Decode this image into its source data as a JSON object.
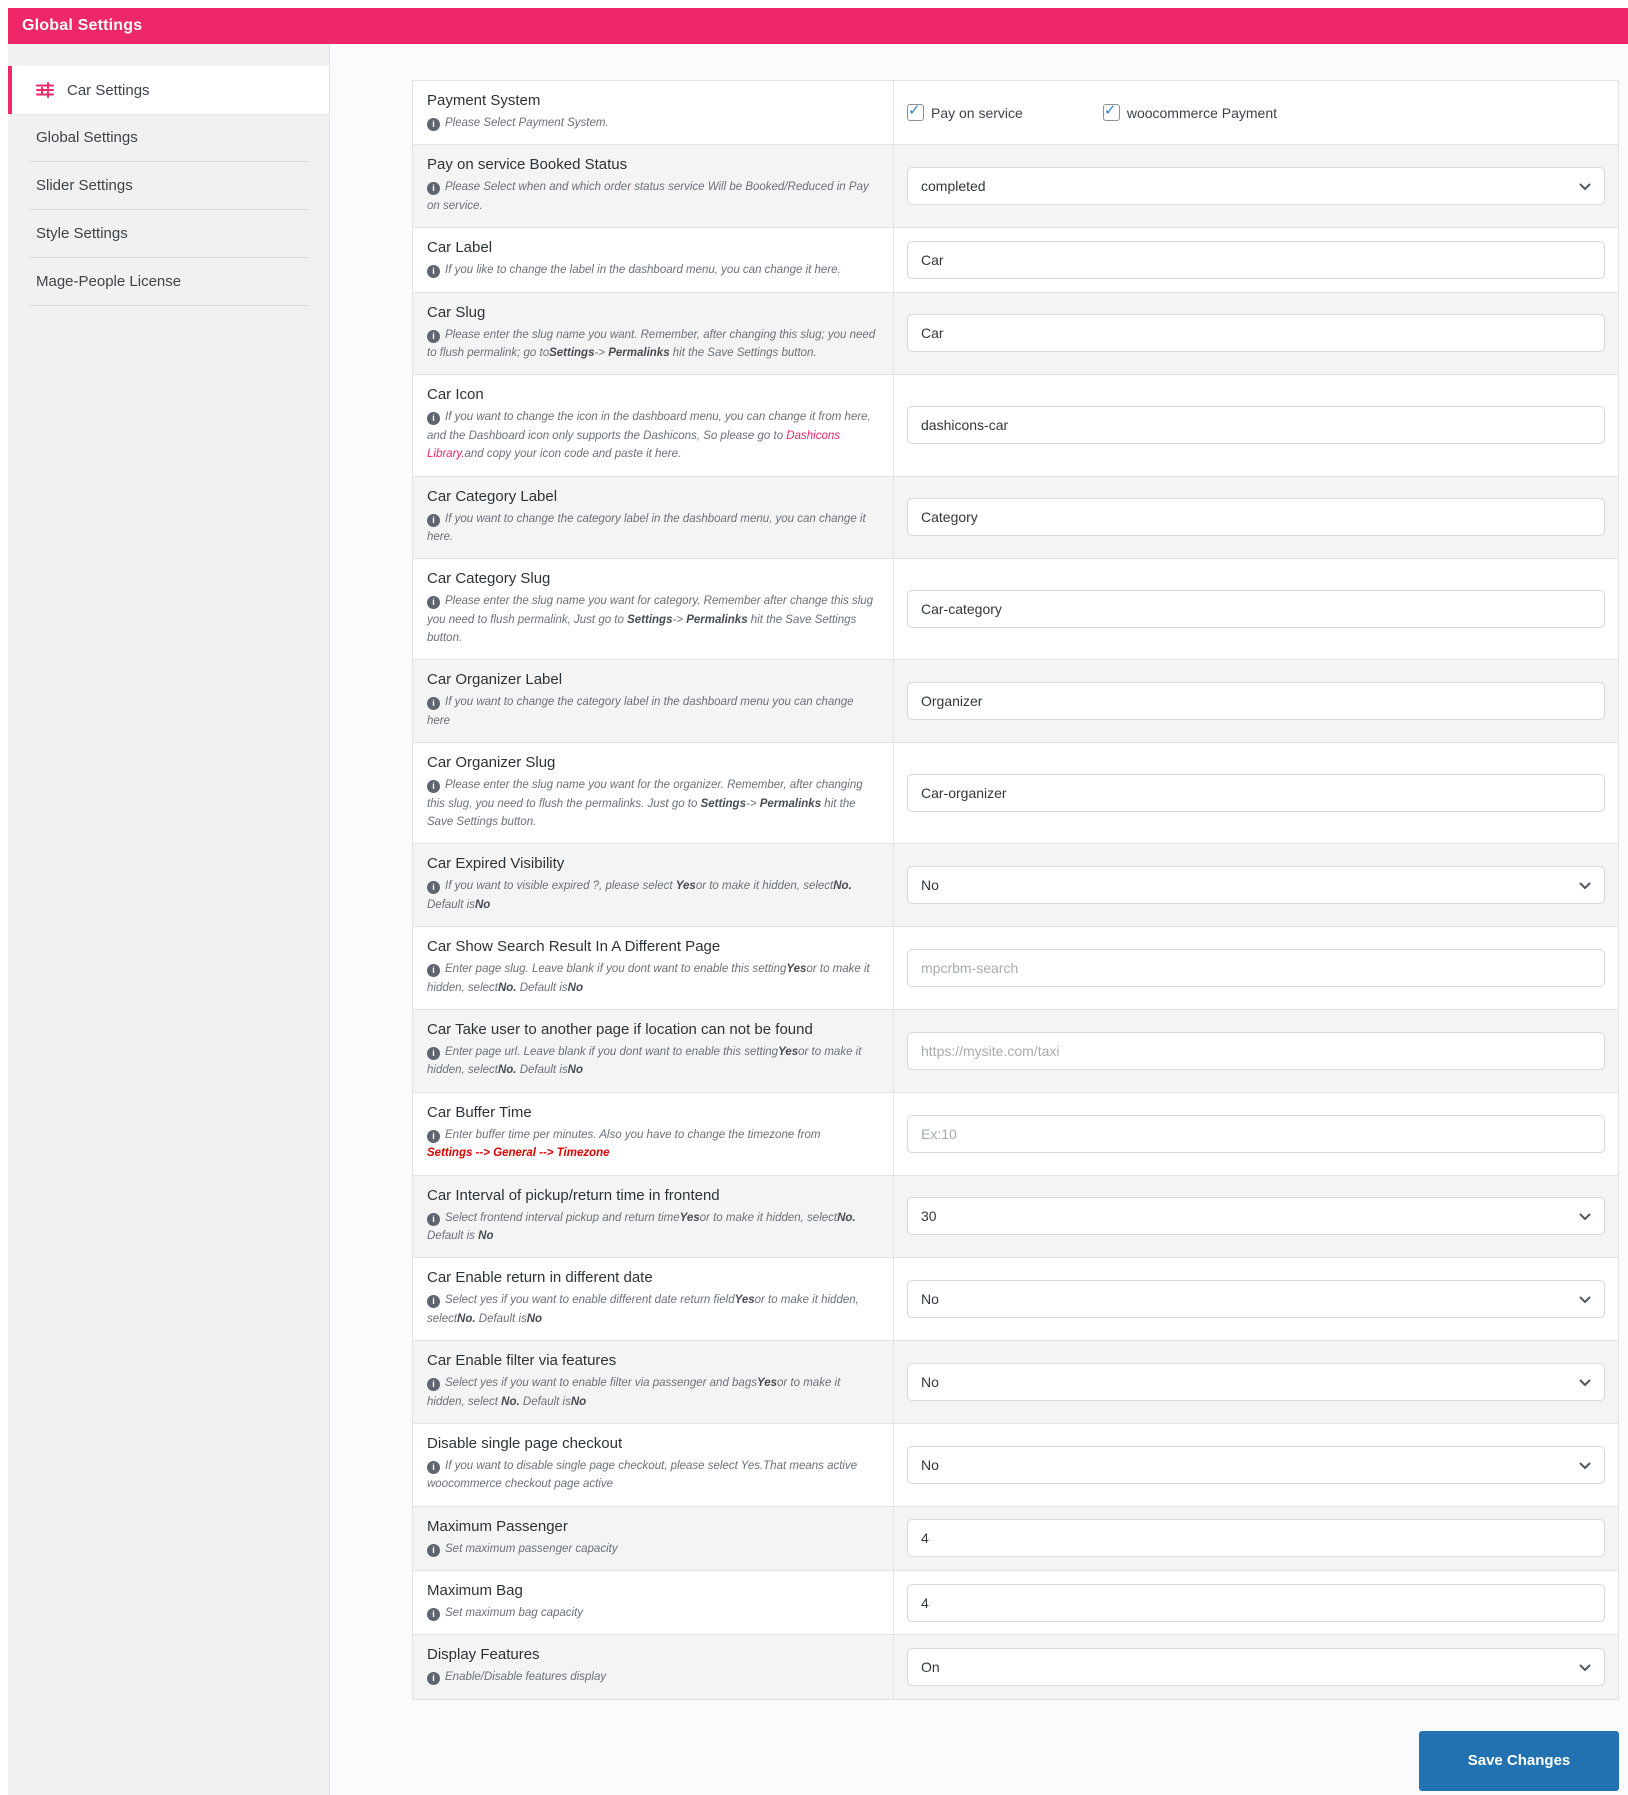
{
  "header": {
    "title": "Global Settings"
  },
  "colors": {
    "accent_pink": "#ed2768",
    "button_blue": "#2271b1",
    "link_red": "#dd0000",
    "checkbox_check": "#3582c4"
  },
  "sidebar": {
    "items": [
      {
        "label": "Car Settings",
        "active": true,
        "icon": "sliders-icon"
      },
      {
        "label": "Global Settings"
      },
      {
        "label": "Slider Settings"
      },
      {
        "label": "Style Settings"
      },
      {
        "label": "Mage-People License"
      }
    ]
  },
  "settings": {
    "save_label": "Save Changes",
    "rows": [
      {
        "label": "Payment System",
        "desc": [
          {
            "t": "Please Select Payment System."
          }
        ],
        "control": {
          "type": "checkboxes",
          "options": [
            {
              "label": "Pay on service",
              "checked": true
            },
            {
              "label": "woocommerce Payment",
              "checked": true
            }
          ]
        }
      },
      {
        "label": "Pay on service Booked Status",
        "desc": [
          {
            "t": "Please Select when and which order status service Will be Booked/Reduced in Pay on service."
          }
        ],
        "control": {
          "type": "select",
          "value": "completed"
        }
      },
      {
        "label": "Car Label",
        "desc": [
          {
            "t": "If you like to change the label in the dashboard menu, you can change it here."
          }
        ],
        "control": {
          "type": "text",
          "value": "Car"
        }
      },
      {
        "label": "Car Slug",
        "desc": [
          {
            "t": "Please enter the slug name you want. Remember, after changing this slug; you need to flush permalink; go to"
          },
          {
            "t": "Settings",
            "s": "b"
          },
          {
            "t": "-> "
          },
          {
            "t": "Permalinks",
            "s": "b"
          },
          {
            "t": " hit the Save Settings button."
          }
        ],
        "control": {
          "type": "text",
          "value": "Car"
        }
      },
      {
        "label": "Car Icon",
        "desc": [
          {
            "t": "If you want to change the icon in the dashboard menu, you can change it from here, and the Dashboard icon only supports the Dashicons, So please go to "
          },
          {
            "t": "Dashicons Library.",
            "s": "link"
          },
          {
            "t": "and copy your icon code and paste it here."
          }
        ],
        "control": {
          "type": "text",
          "value": "dashicons-car"
        }
      },
      {
        "label": "Car Category Label",
        "desc": [
          {
            "t": "If you want to change the category label in the dashboard menu, you can change it here."
          }
        ],
        "control": {
          "type": "text",
          "value": "Category"
        }
      },
      {
        "label": "Car Category Slug",
        "desc": [
          {
            "t": "Please enter the slug name you want for category. Remember after change this slug you need to flush permalink, Just go to "
          },
          {
            "t": "Settings",
            "s": "b"
          },
          {
            "t": "-> "
          },
          {
            "t": "Permalinks",
            "s": "b"
          },
          {
            "t": " hit the Save Settings button."
          }
        ],
        "control": {
          "type": "text",
          "value": "Car-category"
        }
      },
      {
        "label": "Car Organizer Label",
        "desc": [
          {
            "t": "If you want to change the category label in the dashboard menu you can change here"
          }
        ],
        "control": {
          "type": "text",
          "value": "Organizer"
        }
      },
      {
        "label": "Car Organizer Slug",
        "desc": [
          {
            "t": "Please enter the slug name you want for the organizer. Remember, after changing this slug, you need to flush the permalinks. Just go to "
          },
          {
            "t": "Settings",
            "s": "b"
          },
          {
            "t": "-> "
          },
          {
            "t": "Permalinks",
            "s": "b"
          },
          {
            "t": " hit the Save Settings button."
          }
        ],
        "control": {
          "type": "text",
          "value": "Car-organizer"
        }
      },
      {
        "label": "Car Expired Visibility",
        "desc": [
          {
            "t": "If you want to visible expired ?, please select "
          },
          {
            "t": "Yes",
            "s": "b"
          },
          {
            "t": "or to make it hidden, select"
          },
          {
            "t": "No.",
            "s": "b"
          },
          {
            "t": " Default is"
          },
          {
            "t": "No",
            "s": "b"
          }
        ],
        "control": {
          "type": "select",
          "value": "No"
        }
      },
      {
        "label": "Car Show Search Result In A Different Page",
        "desc": [
          {
            "t": "Enter page slug. Leave blank if you dont want to enable this setting"
          },
          {
            "t": "Yes",
            "s": "b"
          },
          {
            "t": "or to make it hidden, select"
          },
          {
            "t": "No.",
            "s": "b"
          },
          {
            "t": " Default is"
          },
          {
            "t": "No",
            "s": "b"
          }
        ],
        "control": {
          "type": "text",
          "placeholder": "mpcrbm-search"
        }
      },
      {
        "label": "Car Take user to another page if location can not be found",
        "desc": [
          {
            "t": "Enter page url. Leave blank if you dont want to enable this setting"
          },
          {
            "t": "Yes",
            "s": "b"
          },
          {
            "t": "or to make it hidden, select"
          },
          {
            "t": "No.",
            "s": "b"
          },
          {
            "t": " Default is"
          },
          {
            "t": "No",
            "s": "b"
          }
        ],
        "control": {
          "type": "text",
          "placeholder": "https://mysite.com/taxi"
        }
      },
      {
        "label": "Car Buffer Time",
        "desc": [
          {
            "t": "Enter buffer time per minutes. Also you have to change the timezone from"
          },
          {
            "br": true
          },
          {
            "t": "Settings --> General --> Timezone",
            "s": "red"
          }
        ],
        "control": {
          "type": "text",
          "placeholder": "Ex:10"
        }
      },
      {
        "label": "Car Interval of pickup/return time in frontend",
        "desc": [
          {
            "t": "Select frontend interval pickup and return time"
          },
          {
            "t": "Yes",
            "s": "b"
          },
          {
            "t": "or to make it hidden, select"
          },
          {
            "t": "No.",
            "s": "b"
          },
          {
            "t": " Default is "
          },
          {
            "t": "No",
            "s": "b"
          }
        ],
        "control": {
          "type": "select",
          "value": "30"
        }
      },
      {
        "label": "Car Enable return in different date",
        "desc": [
          {
            "t": "Select yes if you want to enable different date return field"
          },
          {
            "t": "Yes",
            "s": "b"
          },
          {
            "t": "or to make it hidden, select"
          },
          {
            "t": "No.",
            "s": "b"
          },
          {
            "t": " Default is"
          },
          {
            "t": "No",
            "s": "b"
          }
        ],
        "control": {
          "type": "select",
          "value": "No"
        }
      },
      {
        "label": "Car Enable filter via features",
        "desc": [
          {
            "t": "Select yes if you want to enable filter via passenger and bags"
          },
          {
            "t": "Yes",
            "s": "b"
          },
          {
            "t": "or to make it hidden, select "
          },
          {
            "t": "No.",
            "s": "b"
          },
          {
            "t": " Default is"
          },
          {
            "t": "No",
            "s": "b"
          }
        ],
        "control": {
          "type": "select",
          "value": "No"
        }
      },
      {
        "label": "Disable single page checkout",
        "desc": [
          {
            "t": "If you want to disable single page checkout, please select Yes.That means active woocommerce checkout page active"
          }
        ],
        "control": {
          "type": "select",
          "value": "No"
        }
      },
      {
        "label": "Maximum Passenger",
        "desc": [
          {
            "t": "Set maximum passenger capacity"
          }
        ],
        "control": {
          "type": "text",
          "value": "4"
        }
      },
      {
        "label": "Maximum Bag",
        "desc": [
          {
            "t": "Set maximum bag capacity"
          }
        ],
        "control": {
          "type": "text",
          "value": "4"
        }
      },
      {
        "label": "Display Features",
        "desc": [
          {
            "t": "Enable/Disable features display"
          }
        ],
        "control": {
          "type": "select",
          "value": "On"
        }
      }
    ]
  }
}
